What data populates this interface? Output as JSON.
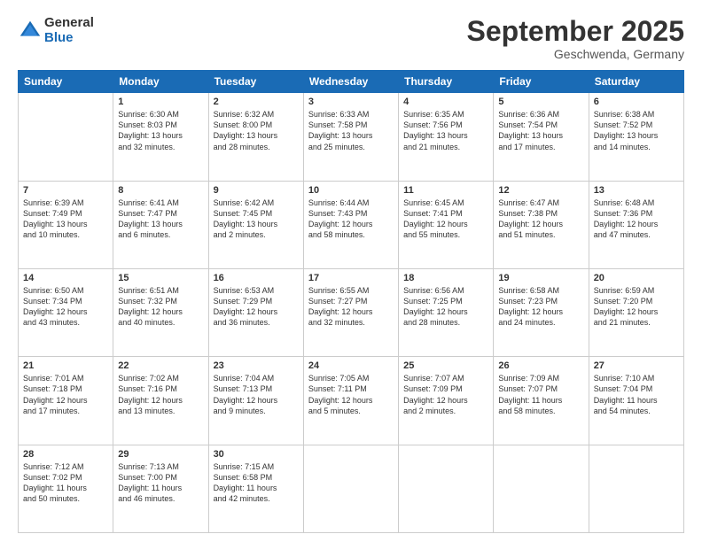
{
  "header": {
    "logo_general": "General",
    "logo_blue": "Blue",
    "month": "September 2025",
    "location": "Geschwenda, Germany"
  },
  "days_of_week": [
    "Sunday",
    "Monday",
    "Tuesday",
    "Wednesday",
    "Thursday",
    "Friday",
    "Saturday"
  ],
  "weeks": [
    [
      {
        "day": "",
        "text": ""
      },
      {
        "day": "1",
        "text": "Sunrise: 6:30 AM\nSunset: 8:03 PM\nDaylight: 13 hours\nand 32 minutes."
      },
      {
        "day": "2",
        "text": "Sunrise: 6:32 AM\nSunset: 8:00 PM\nDaylight: 13 hours\nand 28 minutes."
      },
      {
        "day": "3",
        "text": "Sunrise: 6:33 AM\nSunset: 7:58 PM\nDaylight: 13 hours\nand 25 minutes."
      },
      {
        "day": "4",
        "text": "Sunrise: 6:35 AM\nSunset: 7:56 PM\nDaylight: 13 hours\nand 21 minutes."
      },
      {
        "day": "5",
        "text": "Sunrise: 6:36 AM\nSunset: 7:54 PM\nDaylight: 13 hours\nand 17 minutes."
      },
      {
        "day": "6",
        "text": "Sunrise: 6:38 AM\nSunset: 7:52 PM\nDaylight: 13 hours\nand 14 minutes."
      }
    ],
    [
      {
        "day": "7",
        "text": "Sunrise: 6:39 AM\nSunset: 7:49 PM\nDaylight: 13 hours\nand 10 minutes."
      },
      {
        "day": "8",
        "text": "Sunrise: 6:41 AM\nSunset: 7:47 PM\nDaylight: 13 hours\nand 6 minutes."
      },
      {
        "day": "9",
        "text": "Sunrise: 6:42 AM\nSunset: 7:45 PM\nDaylight: 13 hours\nand 2 minutes."
      },
      {
        "day": "10",
        "text": "Sunrise: 6:44 AM\nSunset: 7:43 PM\nDaylight: 12 hours\nand 58 minutes."
      },
      {
        "day": "11",
        "text": "Sunrise: 6:45 AM\nSunset: 7:41 PM\nDaylight: 12 hours\nand 55 minutes."
      },
      {
        "day": "12",
        "text": "Sunrise: 6:47 AM\nSunset: 7:38 PM\nDaylight: 12 hours\nand 51 minutes."
      },
      {
        "day": "13",
        "text": "Sunrise: 6:48 AM\nSunset: 7:36 PM\nDaylight: 12 hours\nand 47 minutes."
      }
    ],
    [
      {
        "day": "14",
        "text": "Sunrise: 6:50 AM\nSunset: 7:34 PM\nDaylight: 12 hours\nand 43 minutes."
      },
      {
        "day": "15",
        "text": "Sunrise: 6:51 AM\nSunset: 7:32 PM\nDaylight: 12 hours\nand 40 minutes."
      },
      {
        "day": "16",
        "text": "Sunrise: 6:53 AM\nSunset: 7:29 PM\nDaylight: 12 hours\nand 36 minutes."
      },
      {
        "day": "17",
        "text": "Sunrise: 6:55 AM\nSunset: 7:27 PM\nDaylight: 12 hours\nand 32 minutes."
      },
      {
        "day": "18",
        "text": "Sunrise: 6:56 AM\nSunset: 7:25 PM\nDaylight: 12 hours\nand 28 minutes."
      },
      {
        "day": "19",
        "text": "Sunrise: 6:58 AM\nSunset: 7:23 PM\nDaylight: 12 hours\nand 24 minutes."
      },
      {
        "day": "20",
        "text": "Sunrise: 6:59 AM\nSunset: 7:20 PM\nDaylight: 12 hours\nand 21 minutes."
      }
    ],
    [
      {
        "day": "21",
        "text": "Sunrise: 7:01 AM\nSunset: 7:18 PM\nDaylight: 12 hours\nand 17 minutes."
      },
      {
        "day": "22",
        "text": "Sunrise: 7:02 AM\nSunset: 7:16 PM\nDaylight: 12 hours\nand 13 minutes."
      },
      {
        "day": "23",
        "text": "Sunrise: 7:04 AM\nSunset: 7:13 PM\nDaylight: 12 hours\nand 9 minutes."
      },
      {
        "day": "24",
        "text": "Sunrise: 7:05 AM\nSunset: 7:11 PM\nDaylight: 12 hours\nand 5 minutes."
      },
      {
        "day": "25",
        "text": "Sunrise: 7:07 AM\nSunset: 7:09 PM\nDaylight: 12 hours\nand 2 minutes."
      },
      {
        "day": "26",
        "text": "Sunrise: 7:09 AM\nSunset: 7:07 PM\nDaylight: 11 hours\nand 58 minutes."
      },
      {
        "day": "27",
        "text": "Sunrise: 7:10 AM\nSunset: 7:04 PM\nDaylight: 11 hours\nand 54 minutes."
      }
    ],
    [
      {
        "day": "28",
        "text": "Sunrise: 7:12 AM\nSunset: 7:02 PM\nDaylight: 11 hours\nand 50 minutes."
      },
      {
        "day": "29",
        "text": "Sunrise: 7:13 AM\nSunset: 7:00 PM\nDaylight: 11 hours\nand 46 minutes."
      },
      {
        "day": "30",
        "text": "Sunrise: 7:15 AM\nSunset: 6:58 PM\nDaylight: 11 hours\nand 42 minutes."
      },
      {
        "day": "",
        "text": ""
      },
      {
        "day": "",
        "text": ""
      },
      {
        "day": "",
        "text": ""
      },
      {
        "day": "",
        "text": ""
      }
    ]
  ]
}
